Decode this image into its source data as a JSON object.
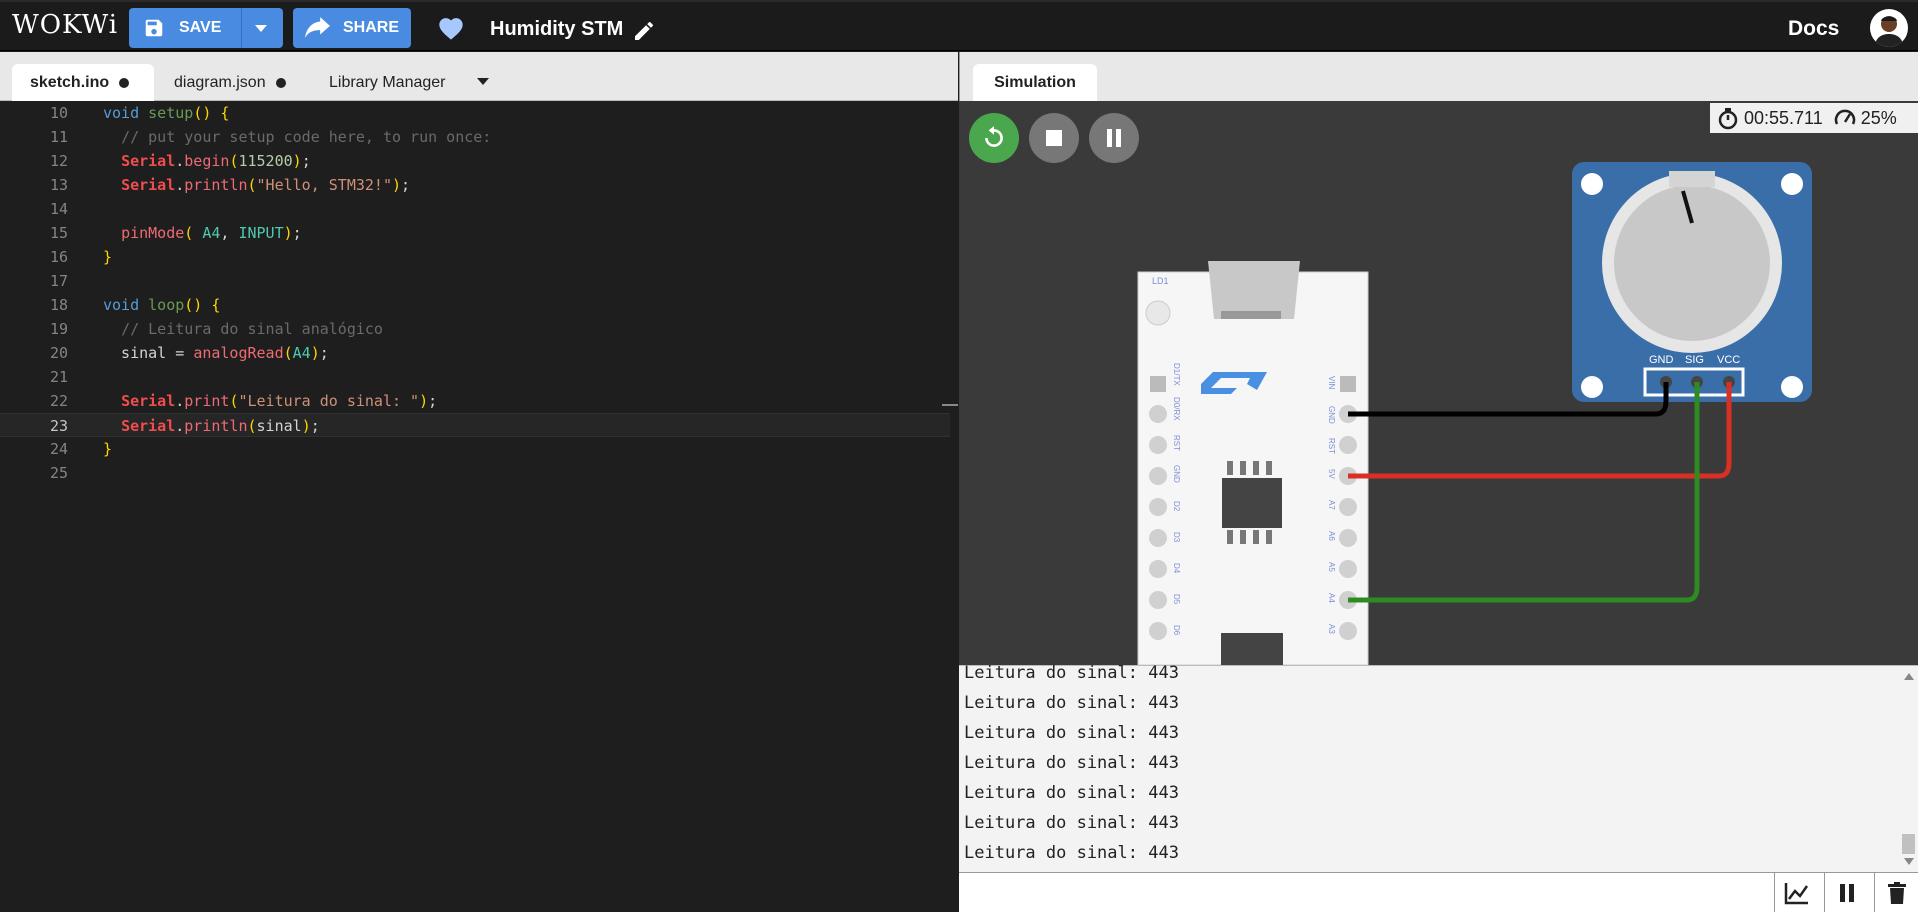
{
  "app": {
    "logo": "WOKWi",
    "project_title": "Humidity STM",
    "docs_label": "Docs"
  },
  "toolbar": {
    "save_label": "SAVE",
    "share_label": "SHARE"
  },
  "editor_tabs": [
    {
      "label": "sketch.ino",
      "modified": true,
      "active": true
    },
    {
      "label": "diagram.json",
      "modified": true,
      "active": false
    },
    {
      "label": "Library Manager",
      "modified": false,
      "active": false
    }
  ],
  "code": {
    "line_numbers": [
      "10",
      "11",
      "12",
      "13",
      "14",
      "15",
      "16",
      "17",
      "18",
      "19",
      "20",
      "21",
      "22",
      "23",
      "24",
      "25"
    ],
    "current_line": "23"
  },
  "simulation": {
    "tab_label": "Simulation",
    "timer": "00:55.711",
    "speed": "25%",
    "board_labels": {
      "led": "LD1",
      "left_pins": [
        "D1/TX",
        "D0/RX",
        "RST",
        "GND",
        "D2",
        "D3",
        "D4",
        "D5",
        "D6"
      ],
      "right_pins": [
        "VIN",
        "GND",
        "RST",
        "5V",
        "A7",
        "A6",
        "A5",
        "A4",
        "A3"
      ]
    },
    "pot_labels": [
      "GND",
      "SIG",
      "VCC"
    ],
    "wire_colors": {
      "gnd": "#000000",
      "vcc": "#d93025",
      "sig": "#2e8b22"
    }
  },
  "serial_monitor": {
    "lines": [
      "Leitura do sinal: 443",
      "Leitura do sinal: 443",
      "Leitura do sinal: 443",
      "Leitura do sinal: 443",
      "Leitura do sinal: 443",
      "Leitura do sinal: 443",
      "Leitura do sinal: 443"
    ]
  }
}
